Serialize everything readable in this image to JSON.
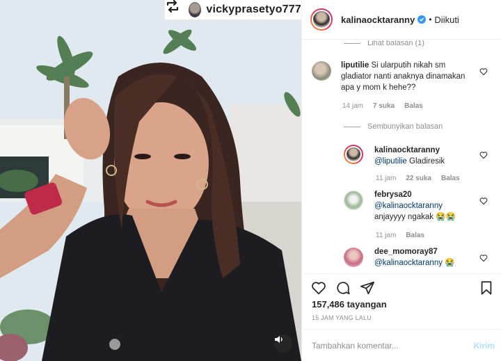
{
  "media": {
    "repost_username": "vickyprasetyo777",
    "icons": {
      "repost": "repost-icon",
      "sound": "speaker-icon"
    }
  },
  "header": {
    "username": "kalinaocktaranny",
    "separator": "•",
    "follow_status": "Diikuti"
  },
  "comments": {
    "view_replies_partial": "Lihat balasan (1)",
    "hide_replies": "Sembunyikan balasan",
    "items": [
      {
        "username": "liputilie",
        "text": "Si ularputih nikah sm gladiator nanti anaknya dinamakan apa y mom k hehe??",
        "time": "14 jam",
        "likes": "7 suka",
        "reply": "Balas"
      }
    ],
    "replies": [
      {
        "username": "kalinaocktaranny",
        "mention": "@liputilie",
        "text": "Gladiresik",
        "time": "11 jam",
        "likes": "22 suka",
        "reply": "Balas"
      },
      {
        "username": "febrysa20",
        "mention": "@kalinaocktaranny",
        "text": "anjayyyy ngakak 😭😭",
        "time": "11 jam",
        "reply": "Balas"
      },
      {
        "username": "dee_momoray87",
        "mention": "@kalinaocktaranny",
        "text": "😭"
      }
    ]
  },
  "actions": {
    "icons": [
      "heart-icon",
      "comment-icon",
      "share-icon",
      "bookmark-icon"
    ]
  },
  "stats": {
    "views": "157,486 tayangan",
    "time_ago": "15 JAM YANG LALU"
  },
  "composer": {
    "placeholder": "Tambahkan komentar...",
    "post_label": "Kirim"
  },
  "colors": {
    "verified": "#3897f0",
    "mention": "#00376b",
    "muted": "#8e8e8e",
    "post_disabled": "#b2dffc"
  }
}
